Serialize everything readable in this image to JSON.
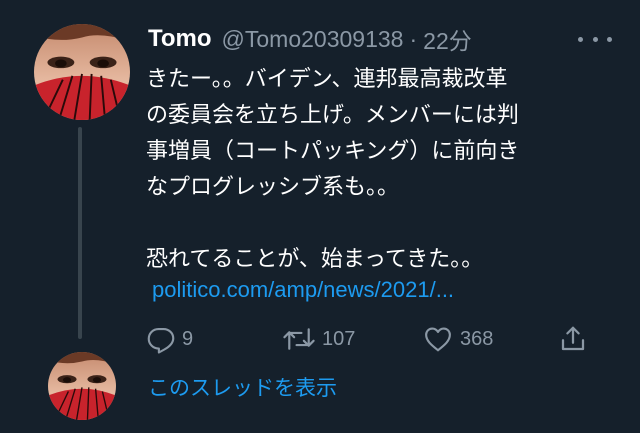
{
  "tweet": {
    "display_name": "Tomo",
    "handle": "@Tomo20309138",
    "separator": "·",
    "time": "22分",
    "body_lines": [
      "きたー。。バイデン、連邦最高裁改革",
      "の委員会を立ち上げ。メンバーには判",
      "事増員（コートパッキング）に前向き",
      "なプログレッシブ系も。。",
      "",
      "恐れてることが、始まってきた。。"
    ],
    "link": "politico.com/amp/news/2021/...",
    "actions": {
      "reply_count": "9",
      "retweet_count": "107",
      "like_count": "368"
    },
    "show_thread": "このスレッドを表示"
  },
  "icons": [
    "avatar",
    "more-icon",
    "reply-icon",
    "retweet-icon",
    "like-icon",
    "share-icon"
  ],
  "colors": {
    "background": "#15202b",
    "text": "#ffffff",
    "secondary": "#8b98a5",
    "link": "#1d9bf0",
    "thread_line": "#38444d"
  }
}
